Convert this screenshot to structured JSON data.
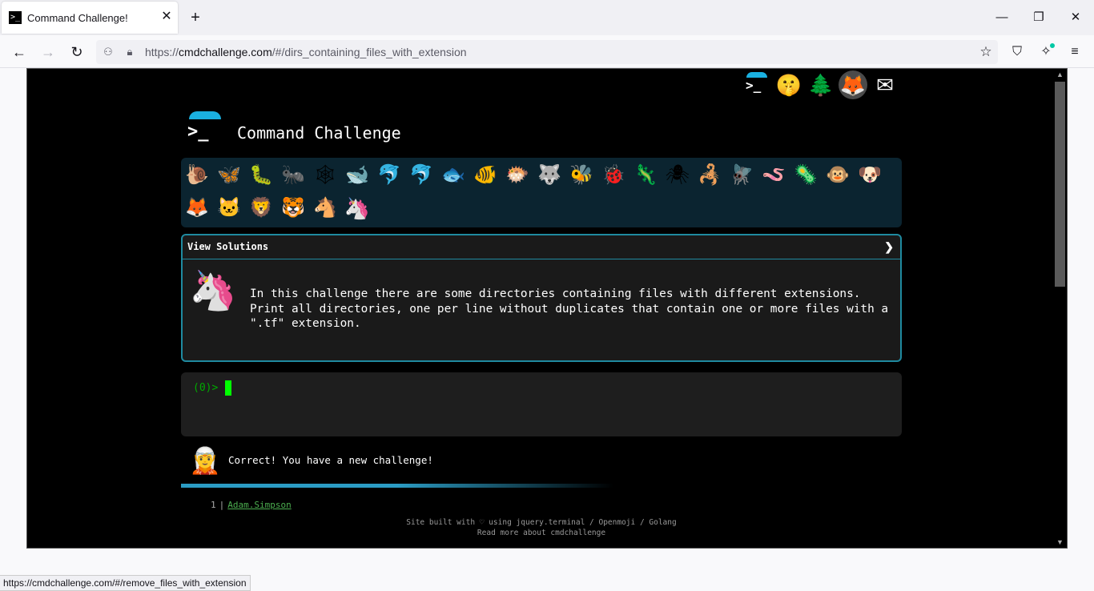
{
  "browser": {
    "tab_title": "Command Challenge!",
    "tab_favicon": ">_",
    "url_prefix": "https://",
    "url_host": "cmdchallenge.com",
    "url_path": "/#/dirs_containing_files_with_extension",
    "status_url": "https://cmdchallenge.com/#/remove_files_with_extension"
  },
  "site": {
    "title": "Command Challenge",
    "top_icons": [
      "terminal-icon",
      "shushing-face-icon",
      "tree-icon",
      "gitlab-icon",
      "mail-icon"
    ],
    "animals": [
      {
        "name": "snail",
        "glyph": "🐌"
      },
      {
        "name": "butterfly",
        "glyph": "🦋"
      },
      {
        "name": "caterpillar",
        "glyph": "🐛"
      },
      {
        "name": "ant",
        "glyph": "🐜"
      },
      {
        "name": "spider-web",
        "glyph": "🕸"
      },
      {
        "name": "whale",
        "glyph": "🐋"
      },
      {
        "name": "dolphin-blue",
        "glyph": "🐬"
      },
      {
        "name": "dolphin-grey",
        "glyph": "🐬"
      },
      {
        "name": "fish",
        "glyph": "🐟"
      },
      {
        "name": "tropical-fish",
        "glyph": "🐠"
      },
      {
        "name": "blowfish",
        "glyph": "🐡"
      },
      {
        "name": "wolf",
        "glyph": "🐺"
      },
      {
        "name": "bee",
        "glyph": "🐝"
      },
      {
        "name": "ladybug",
        "glyph": "🐞"
      },
      {
        "name": "lizard",
        "glyph": "🦎"
      },
      {
        "name": "spider",
        "glyph": "🕷"
      },
      {
        "name": "scorpion",
        "glyph": "🦂"
      },
      {
        "name": "fly",
        "glyph": "🪰"
      },
      {
        "name": "worm",
        "glyph": "🪱"
      },
      {
        "name": "microbe",
        "glyph": "🦠"
      },
      {
        "name": "monkey",
        "glyph": "🐵"
      },
      {
        "name": "dog",
        "glyph": "🐶"
      },
      {
        "name": "fox",
        "glyph": "🦊"
      },
      {
        "name": "cat",
        "glyph": "🐱"
      },
      {
        "name": "lion",
        "glyph": "🦁"
      },
      {
        "name": "tiger",
        "glyph": "🐯"
      },
      {
        "name": "horse",
        "glyph": "🐴"
      },
      {
        "name": "unicorn",
        "glyph": "🦄"
      }
    ],
    "solutions_label": "View Solutions",
    "solutions_toggle": "❯",
    "challenge_avatar": "🦄",
    "challenge_text": "In this challenge there are some directories containing files with different extensions. Print all directories, one per line without duplicates that contain one or more files with a \".tf\" extension.",
    "prompt": "(0)> ",
    "correct_avatar": "🧝",
    "correct_message": "Correct! You have a new challenge!",
    "progress_fraction": 0.5,
    "leaderboard": [
      {
        "rank": "1",
        "name": "Adam.Simpson"
      }
    ],
    "footer_line1": "Site built with ♡ using jquery.terminal / Openmoji / Golang",
    "footer_line2": "Read more about cmdchallenge"
  }
}
